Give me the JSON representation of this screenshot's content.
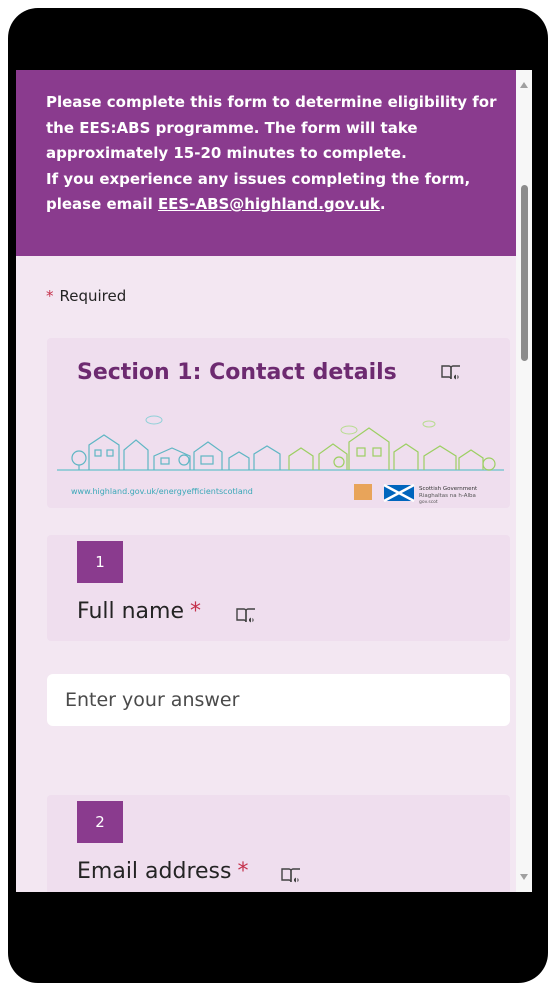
{
  "banner": {
    "line1": "Please complete this form to determine eligibility for the EES:ABS programme. The form will take approximately 15-20 minutes to complete.",
    "line2_prefix": "If you experience any issues completing the form, please email ",
    "email": "EES-ABS@highland.gov.uk",
    "line2_suffix": ".",
    "background_color": "#8a3b8e"
  },
  "required_note": {
    "star": "*",
    "label": "Required"
  },
  "section": {
    "title": "Section 1: Contact details",
    "icon": "immersive-reader-icon",
    "image": {
      "url_text": "www.highland.gov.uk/energyefficientscotland",
      "logo_text": "Scottish Government",
      "logo_subtext": "Riaghaltas na h-Alba",
      "logo_subtext2": "gov.scot"
    }
  },
  "questions": [
    {
      "number": "1",
      "label": "Full name",
      "required_mark": "*",
      "placeholder": "Enter your answer"
    },
    {
      "number": "2",
      "label": "Email address",
      "required_mark": "*"
    }
  ],
  "colors": {
    "accent": "#8a3b8e",
    "page_background": "#f3e7f2",
    "card_background": "#efdeee",
    "required": "#c4314b"
  }
}
